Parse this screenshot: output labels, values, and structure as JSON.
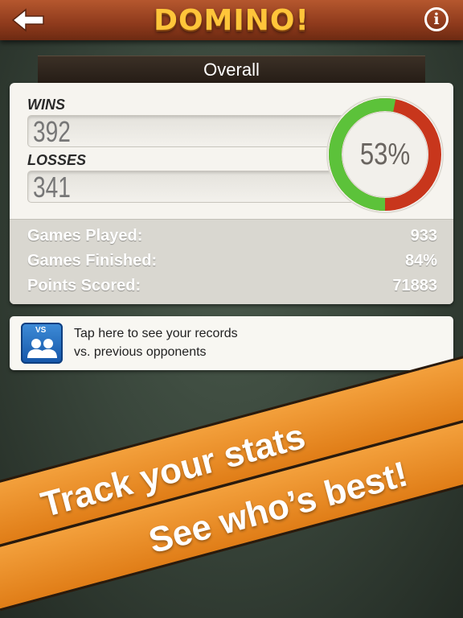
{
  "header": {
    "title": "DOMINO!",
    "back_icon": "back-arrow-icon",
    "info_icon": "info-icon",
    "info_glyph": "i",
    "colors": {
      "bar": "#9a4522",
      "title": "#ffc53a"
    }
  },
  "section": {
    "title": "Overall"
  },
  "stats": {
    "wins_label": "WINS",
    "wins_value": "392",
    "losses_label": "LOSSES",
    "losses_value": "341",
    "win_percent_text": "53%",
    "win_fraction": 0.53,
    "colors": {
      "wins": "#5cc23a",
      "losses": "#c8361c"
    }
  },
  "summary": {
    "rows": [
      {
        "label": "Games Played:",
        "value": "933"
      },
      {
        "label": "Games Finished:",
        "value": "84%"
      },
      {
        "label": "Points Scored:",
        "value": "71883"
      }
    ]
  },
  "versus": {
    "badge": "VS",
    "icon": "opponents-icon",
    "line1": "Tap here to see your records",
    "line2": "vs. previous opponents"
  },
  "promo": {
    "line1": "Track your stats",
    "line2": "See who’s best!",
    "color": "#ee9228"
  }
}
